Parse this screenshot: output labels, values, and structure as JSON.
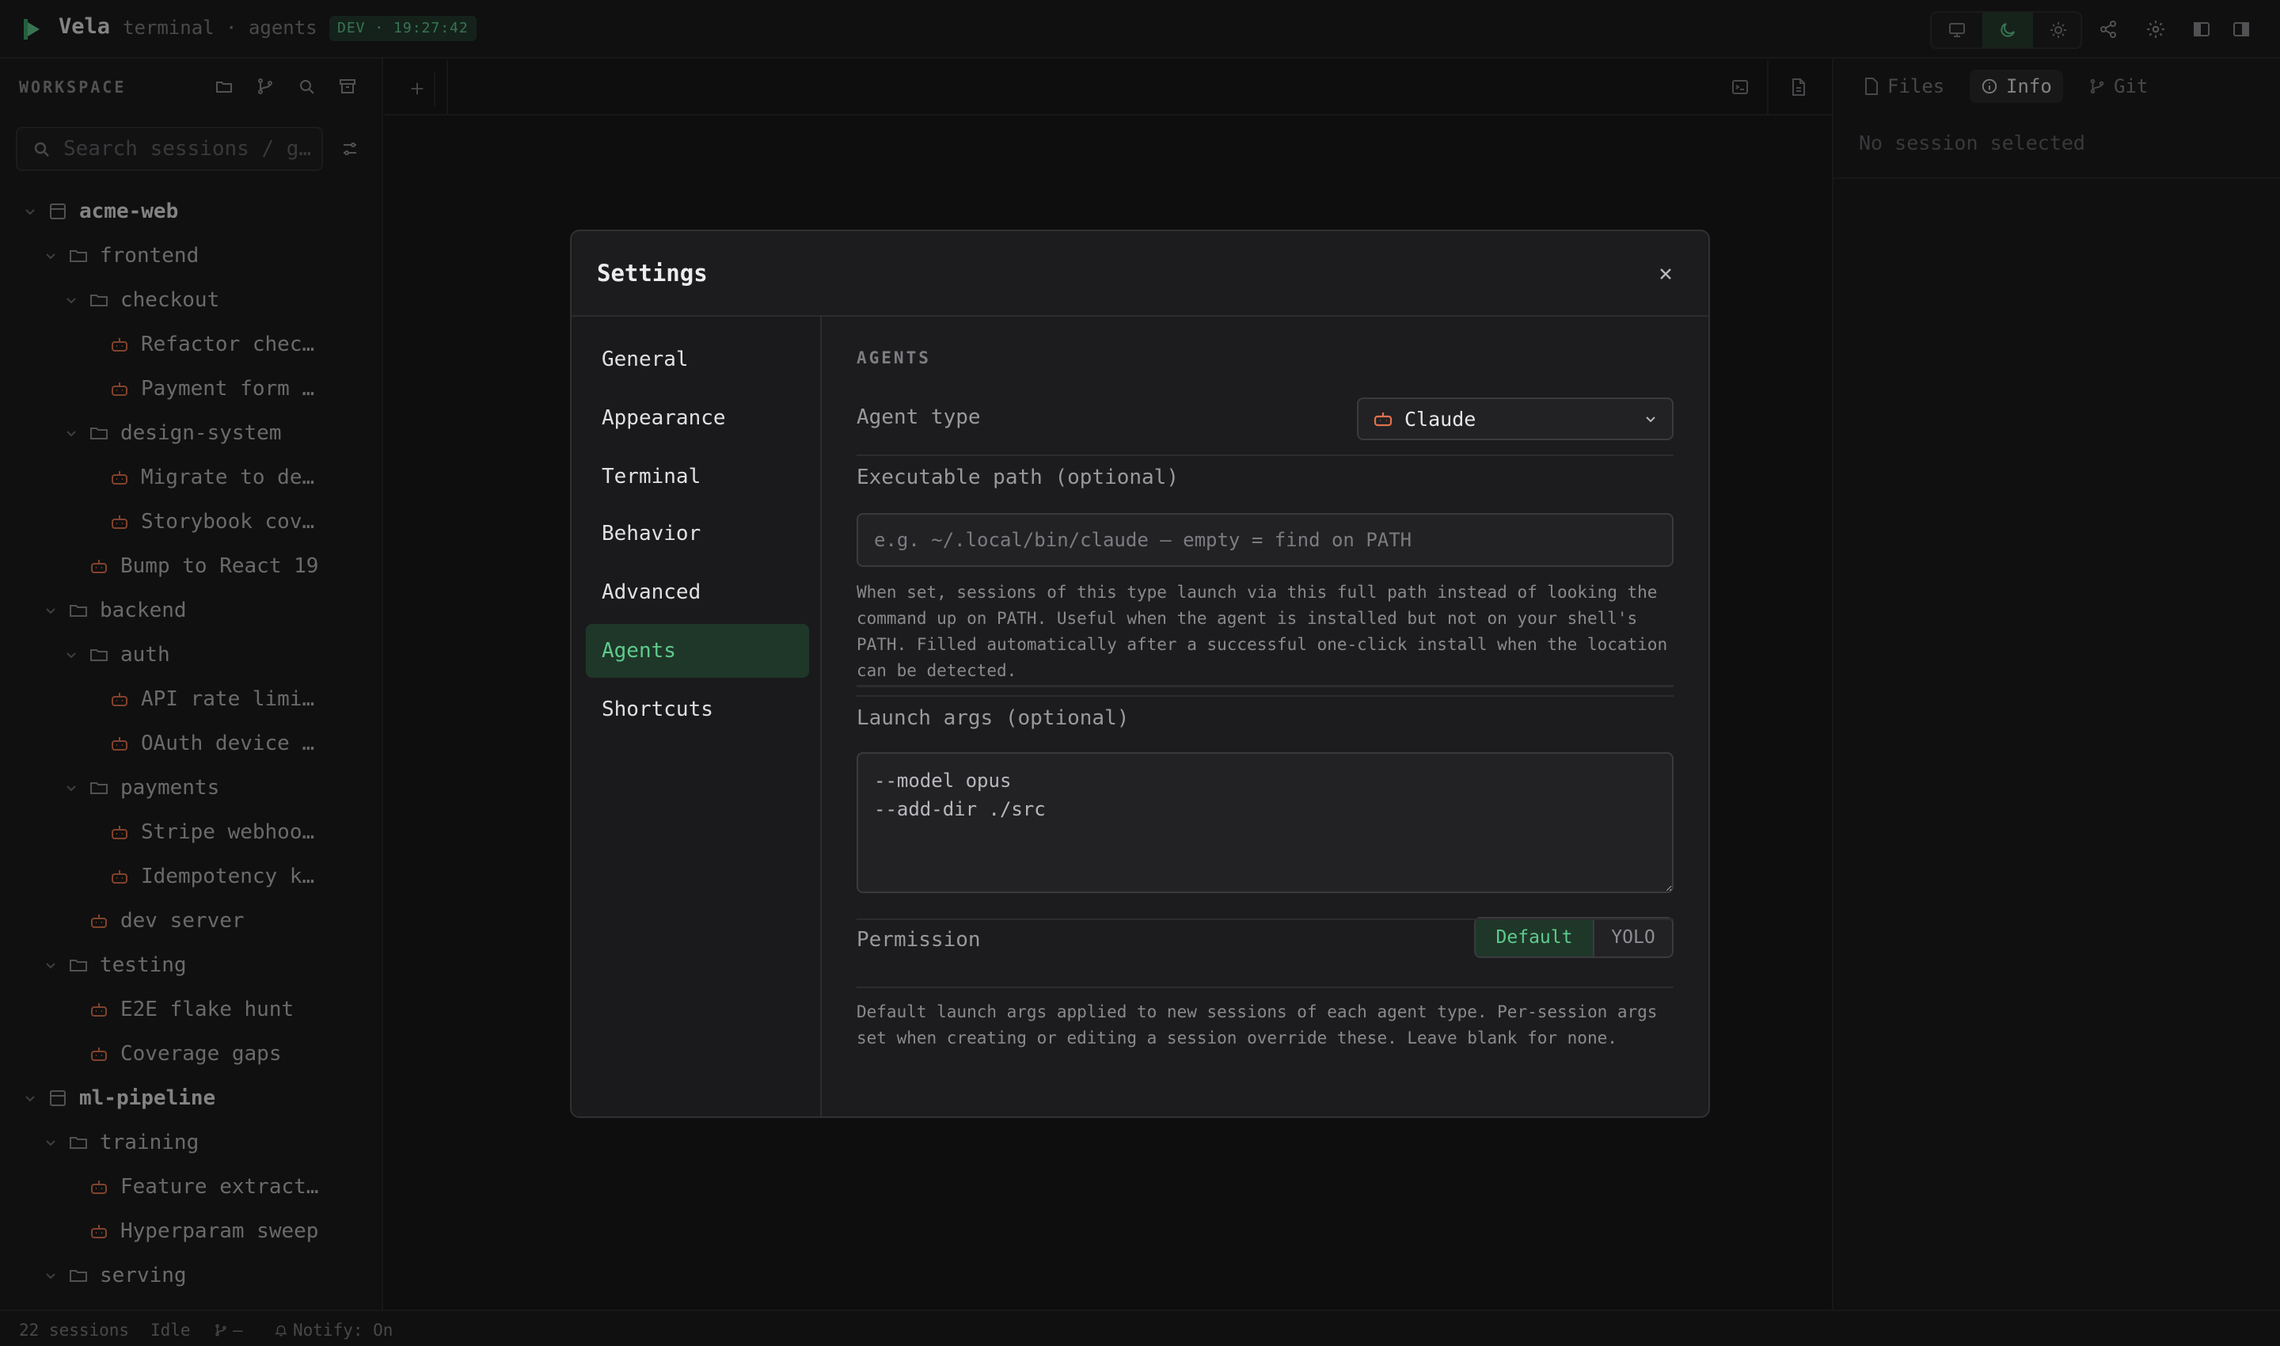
{
  "app": {
    "name": "Vela",
    "subtitle": "terminal · agents",
    "env_badge": "DEV · 19:27:42",
    "accent_color": "#5ecb8c",
    "agent_color": "#e2704a"
  },
  "topbar": {
    "view_modes": [
      "monitor-icon",
      "moon-icon",
      "sun-icon"
    ],
    "active_view_mode": "moon-icon",
    "icons": [
      "share-icon",
      "gear-icon",
      "sidebar-left-icon",
      "sidebar-right-icon"
    ]
  },
  "sidebar": {
    "title": "WORKSPACE",
    "header_icons": [
      "folder-open-icon",
      "git-branch-icon",
      "search-icon",
      "archive-icon"
    ],
    "search_placeholder": "Search sessions / g…",
    "tree": [
      {
        "label": "acme-web",
        "type": "project",
        "depth": 0
      },
      {
        "label": "frontend",
        "type": "folder",
        "depth": 1
      },
      {
        "label": "checkout",
        "type": "folder",
        "depth": 2
      },
      {
        "label": "Refactor chec…",
        "type": "session",
        "depth": 3
      },
      {
        "label": "Payment form …",
        "type": "session",
        "depth": 3
      },
      {
        "label": "design-system",
        "type": "folder",
        "depth": 2
      },
      {
        "label": "Migrate to de…",
        "type": "session",
        "depth": 3
      },
      {
        "label": "Storybook cov…",
        "type": "session",
        "depth": 3
      },
      {
        "label": "Bump to React 19",
        "type": "session",
        "depth": 2
      },
      {
        "label": "backend",
        "type": "folder",
        "depth": 1
      },
      {
        "label": "auth",
        "type": "folder",
        "depth": 2
      },
      {
        "label": "API rate limi…",
        "type": "session",
        "depth": 3
      },
      {
        "label": "OAuth device …",
        "type": "session",
        "depth": 3
      },
      {
        "label": "payments",
        "type": "folder",
        "depth": 2
      },
      {
        "label": "Stripe webhoo…",
        "type": "session",
        "depth": 3
      },
      {
        "label": "Idempotency k…",
        "type": "session",
        "depth": 3
      },
      {
        "label": "dev server",
        "type": "session",
        "depth": 2
      },
      {
        "label": "testing",
        "type": "folder",
        "depth": 1
      },
      {
        "label": "E2E flake hunt",
        "type": "session",
        "depth": 2
      },
      {
        "label": "Coverage gaps",
        "type": "session",
        "depth": 2
      },
      {
        "label": "ml-pipeline",
        "type": "project",
        "depth": 0
      },
      {
        "label": "training",
        "type": "folder",
        "depth": 1
      },
      {
        "label": "Feature extract…",
        "type": "session",
        "depth": 2
      },
      {
        "label": "Hyperparam sweep",
        "type": "session",
        "depth": 2
      },
      {
        "label": "serving",
        "type": "folder",
        "depth": 1
      }
    ]
  },
  "right_panel": {
    "tabs": [
      {
        "label": "Files",
        "icon": "file-icon"
      },
      {
        "label": "Info",
        "icon": "info-icon"
      },
      {
        "label": "Git",
        "icon": "git-branch-icon"
      }
    ],
    "active_tab": "Info",
    "empty_text": "No session selected"
  },
  "statusbar": {
    "sessions": "22 sessions",
    "state": "Idle",
    "branch": "—",
    "notify": "Notify: On"
  },
  "settings": {
    "title": "Settings",
    "nav": [
      "General",
      "Appearance",
      "Terminal",
      "Behavior",
      "Advanced",
      "Agents",
      "Shortcuts"
    ],
    "active_nav": "Agents",
    "section_title": "AGENTS",
    "agent_type_label": "Agent type",
    "agent_type_value": "Claude",
    "exe_label": "Executable path (optional)",
    "exe_placeholder": "e.g. ~/.local/bin/claude — empty = find on PATH",
    "exe_help": "When set, sessions of this type launch via this full path instead of looking the command up on PATH. Useful when the agent is installed but not on your shell's PATH. Filled automatically after a successful one-click install when the location can be detected.",
    "launch_label": "Launch args (optional)",
    "launch_value": "--model opus\n--add-dir ./src",
    "permission_label": "Permission",
    "permission_options": [
      "Default",
      "YOLO"
    ],
    "permission_selected": "Default",
    "footer_help": "Default launch args applied to new sessions of each agent type. Per-session args set when creating or editing a session override these. Leave blank for none."
  }
}
